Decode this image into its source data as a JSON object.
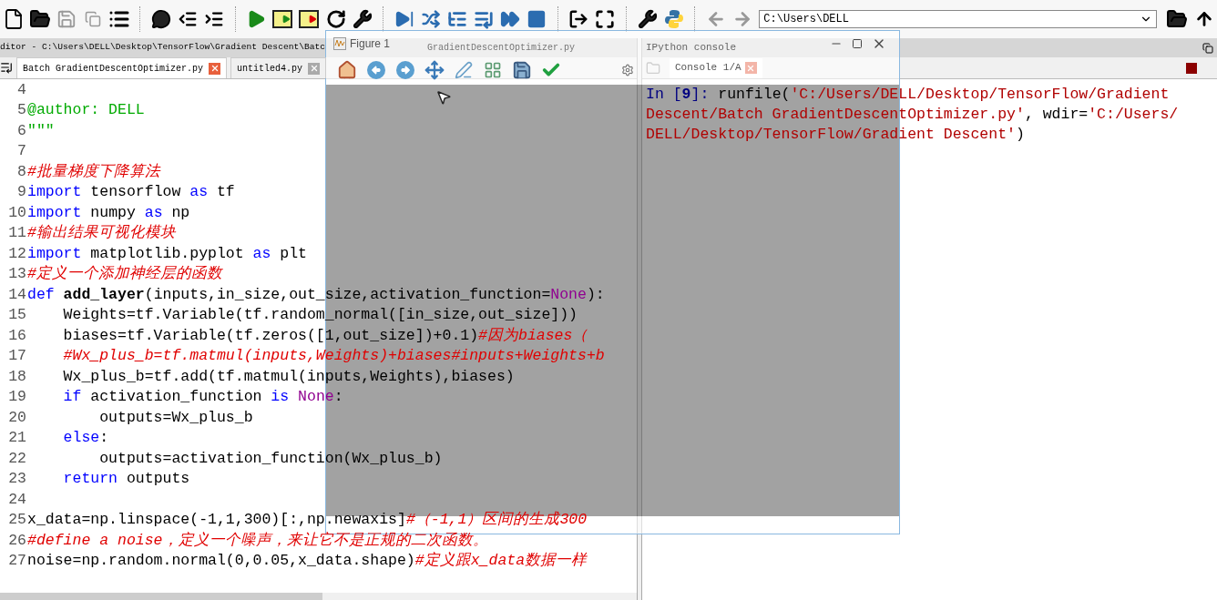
{
  "toolbar": {
    "path_field": {
      "value": "C:\\Users\\DELL"
    }
  },
  "editor": {
    "title": "ditor - C:\\Users\\DELL\\Desktop\\TensorFlow\\Gradient Descent\\Batc",
    "title_continued": "GradientDescentOptimizer.py",
    "tabs": [
      {
        "label": "Batch GradientDescentOptimizer.py",
        "selected": true
      },
      {
        "label": "untitled4.py",
        "selected": false
      }
    ],
    "lines": [
      {
        "number": "4"
      },
      {
        "number": "5",
        "tokens": [
          {
            "kind": "doc",
            "text": "@author: DELL"
          }
        ]
      },
      {
        "number": "6",
        "tokens": [
          {
            "kind": "doc",
            "text": "\"\"\""
          }
        ]
      },
      {
        "number": "7"
      },
      {
        "number": "8",
        "tokens": [
          {
            "kind": "comment",
            "text": "#批量梯度下降算法"
          }
        ]
      },
      {
        "number": "9",
        "tokens": [
          {
            "kind": "keyword",
            "text": "import"
          },
          {
            "kind": "plain",
            "text": " tensorflow "
          },
          {
            "kind": "keyword",
            "text": "as"
          },
          {
            "kind": "plain",
            "text": " tf"
          }
        ]
      },
      {
        "number": "10",
        "tokens": [
          {
            "kind": "keyword",
            "text": "import"
          },
          {
            "kind": "plain",
            "text": " numpy "
          },
          {
            "kind": "keyword",
            "text": "as"
          },
          {
            "kind": "plain",
            "text": " np"
          }
        ]
      },
      {
        "number": "11",
        "tokens": [
          {
            "kind": "comment",
            "text": "#输出结果可视化模块"
          }
        ]
      },
      {
        "number": "12",
        "tokens": [
          {
            "kind": "keyword",
            "text": "import"
          },
          {
            "kind": "plain",
            "text": " matplotlib.pyplot "
          },
          {
            "kind": "keyword",
            "text": "as"
          },
          {
            "kind": "plain",
            "text": " plt"
          }
        ]
      },
      {
        "number": "13",
        "tokens": [
          {
            "kind": "comment",
            "text": "#定义一个添加神经层的函数"
          }
        ]
      },
      {
        "number": "14",
        "tokens": [
          {
            "kind": "keyword",
            "text": "def "
          },
          {
            "kind": "name",
            "text": "add_layer"
          },
          {
            "kind": "plain",
            "text": "(inputs,in_size,out_size,activation_function="
          },
          {
            "kind": "constant",
            "text": "None"
          },
          {
            "kind": "plain",
            "text": "):"
          }
        ]
      },
      {
        "number": "15",
        "tokens": [
          {
            "kind": "plain",
            "text": "    Weights=tf.Variable(tf.random_normal([in_size,out_size]))"
          }
        ]
      },
      {
        "number": "16",
        "tokens": [
          {
            "kind": "plain",
            "text": "    biases=tf.Variable(tf.zeros([1,out_size])+0.1)"
          },
          {
            "kind": "comment",
            "text": "#因为biases（"
          }
        ]
      },
      {
        "number": "17",
        "tokens": [
          {
            "kind": "comment",
            "text": "    #Wx_plus_b=tf.matmul(inputs,Weights)+biases#inputs+Weights+b"
          }
        ]
      },
      {
        "number": "18",
        "tokens": [
          {
            "kind": "plain",
            "text": "    Wx_plus_b=tf.add(tf.matmul(inputs,Weights),biases)"
          }
        ]
      },
      {
        "number": "19",
        "tokens": [
          {
            "kind": "keyword",
            "text": "    if"
          },
          {
            "kind": "plain",
            "text": " activation_function "
          },
          {
            "kind": "keyword",
            "text": "is"
          },
          {
            "kind": "constant",
            "text": " None"
          },
          {
            "kind": "plain",
            "text": ":"
          }
        ]
      },
      {
        "number": "20",
        "tokens": [
          {
            "kind": "plain",
            "text": "        outputs=Wx_plus_b"
          }
        ]
      },
      {
        "number": "21",
        "tokens": [
          {
            "kind": "keyword",
            "text": "    else"
          },
          {
            "kind": "plain",
            "text": ":"
          }
        ]
      },
      {
        "number": "22",
        "tokens": [
          {
            "kind": "plain",
            "text": "        outputs=activation_function(Wx_plus_b)"
          }
        ]
      },
      {
        "number": "23",
        "tokens": [
          {
            "kind": "keyword",
            "text": "    return"
          },
          {
            "kind": "plain",
            "text": " outputs"
          }
        ]
      },
      {
        "number": "24"
      },
      {
        "number": "25",
        "tokens": [
          {
            "kind": "plain",
            "text": "x_data=np.linspace(-1,1,300)[:,np.newaxis]"
          },
          {
            "kind": "comment",
            "text": "#（-1,1）区间的生成300"
          }
        ]
      },
      {
        "number": "26",
        "tokens": [
          {
            "kind": "comment",
            "text": "#define a noise，定义一个噪声，来让它不是正规的二次函数。"
          }
        ]
      },
      {
        "number": "27",
        "tokens": [
          {
            "kind": "plain",
            "text": "noise=np.random.normal(0,0.05,x_data.shape)"
          },
          {
            "kind": "comment",
            "text": "#定义跟x_data数据一样"
          }
        ]
      }
    ]
  },
  "console": {
    "title": "IPython console",
    "tabs": [
      {
        "label": "Console 1/A",
        "selected": true
      }
    ],
    "lines": [
      [
        {
          "kind": "prompt",
          "text": "In ["
        },
        {
          "kind": "count",
          "text": "9"
        },
        {
          "kind": "prompt",
          "text": "]: "
        },
        {
          "kind": "plain",
          "text": "runfile("
        },
        {
          "kind": "string",
          "text": "'C:/Users/DELL/Desktop/TensorFlow/Gradient"
        }
      ],
      [
        {
          "kind": "string",
          "text": "Descent/Batch GradientDescentOptimizer.py'"
        },
        {
          "kind": "plain",
          "text": ", wdir="
        },
        {
          "kind": "string",
          "text": "'C:/Users/"
        }
      ],
      [
        {
          "kind": "string",
          "text": "DELL/Desktop/TensorFlow/Gradient Descent'"
        },
        {
          "kind": "plain",
          "text": ")"
        }
      ]
    ]
  },
  "figure": {
    "title": "Figure 1"
  }
}
